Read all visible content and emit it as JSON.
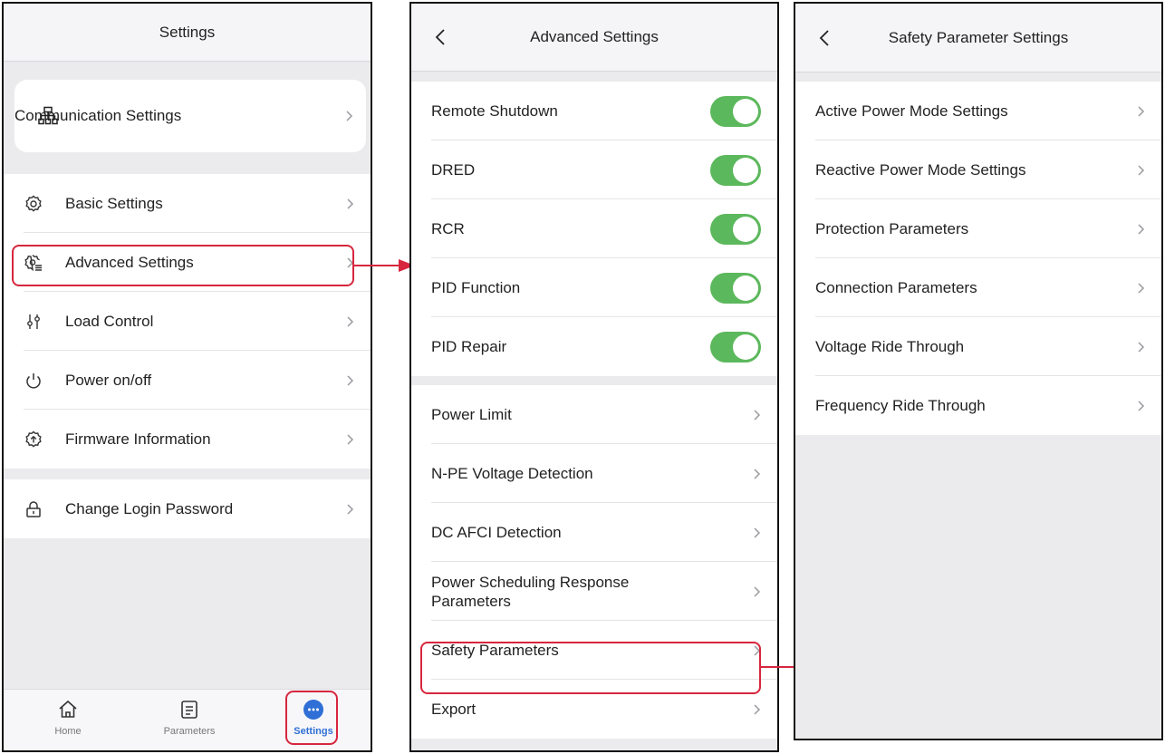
{
  "settings_screen": {
    "title": "Settings",
    "communication": {
      "label": "Communication Settings",
      "icon": "network-icon"
    },
    "items": [
      {
        "label": "Basic Settings",
        "icon": "gear-icon"
      },
      {
        "label": "Advanced Settings",
        "icon": "advanced-gear-icon"
      },
      {
        "label": "Load Control",
        "icon": "sliders-icon"
      },
      {
        "label": "Power on/off",
        "icon": "power-icon"
      },
      {
        "label": "Firmware Information",
        "icon": "firmware-icon"
      }
    ],
    "password": {
      "label": "Change Login Password",
      "icon": "lock-icon"
    },
    "tabs": [
      {
        "label": "Home",
        "icon": "home-icon"
      },
      {
        "label": "Parameters",
        "icon": "document-icon"
      },
      {
        "label": "Settings",
        "icon": "more-icon"
      }
    ]
  },
  "advanced_screen": {
    "title": "Advanced Settings",
    "toggles": [
      {
        "label": "Remote Shutdown",
        "on": true
      },
      {
        "label": "DRED",
        "on": true
      },
      {
        "label": "RCR",
        "on": true
      },
      {
        "label": "PID Function",
        "on": true
      },
      {
        "label": "PID Repair",
        "on": true
      }
    ],
    "items": [
      "Power Limit",
      "N-PE Voltage Detection",
      "DC AFCI Detection",
      "Power Scheduling Response Parameters",
      "Safety Parameters",
      "Export"
    ]
  },
  "safety_screen": {
    "title": "Safety Parameter Settings",
    "items": [
      "Active Power Mode Settings",
      "Reactive Power Mode Settings",
      "Protection Parameters",
      "Connection Parameters",
      "Voltage Ride Through",
      "Frequency Ride Through"
    ]
  },
  "colors": {
    "accent_red": "#d7263d",
    "toggle_green": "#5cb85c",
    "active_tab_blue": "#2f6fd6"
  }
}
